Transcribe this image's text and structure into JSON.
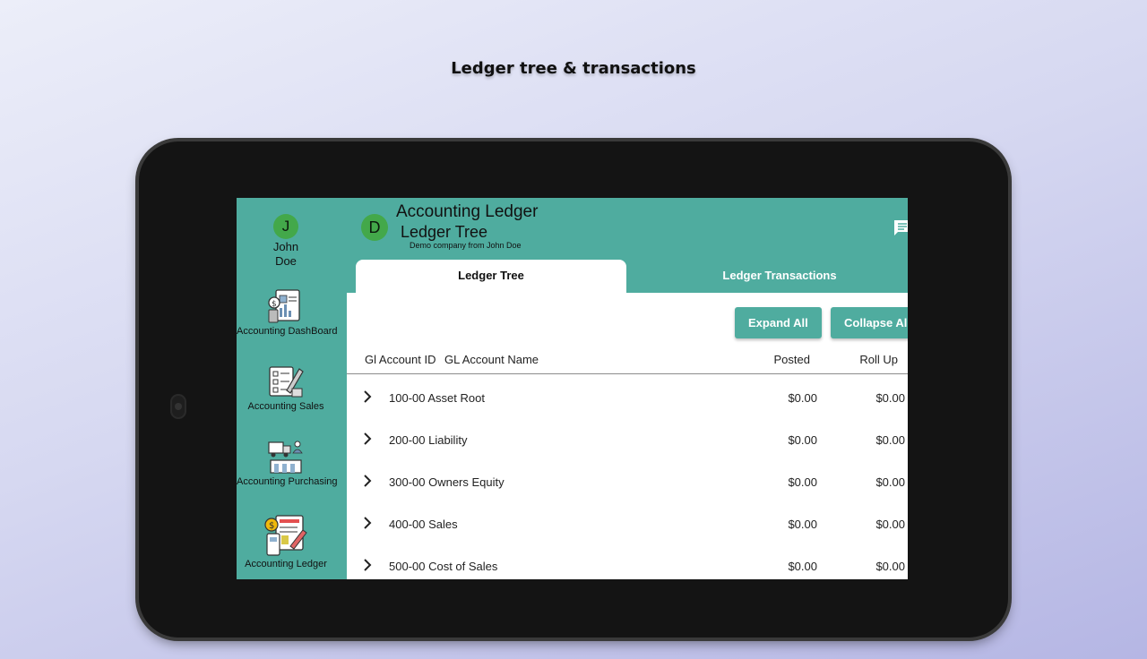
{
  "caption": "Ledger tree & transactions",
  "rail": {
    "user_initial": "J",
    "user_name_line1": "John",
    "user_name_line2": "Doe",
    "items": [
      {
        "label": "Accounting DashBoard",
        "icon": "dashboard-icon"
      },
      {
        "label": "Accounting Sales",
        "icon": "sales-icon"
      },
      {
        "label": "Accounting Purchasing",
        "icon": "purchasing-icon"
      },
      {
        "label": "Accounting Ledger",
        "icon": "ledger-icon"
      }
    ]
  },
  "header": {
    "company_initial": "D",
    "title": "Accounting Ledger",
    "subtitle": "Ledger Tree",
    "company": "Demo company from John Doe",
    "chat_icon": "chat-icon"
  },
  "tabs": [
    "Ledger Tree",
    "Ledger Transactions"
  ],
  "actions": {
    "expand": "Expand All",
    "collapse": "Collapse All"
  },
  "table": {
    "columns": [
      "Gl Account ID",
      "GL Account Name",
      "Posted",
      "Roll Up"
    ],
    "rows": [
      {
        "name": "100-00 Asset Root",
        "posted": "$0.00",
        "rollup": "$0.00"
      },
      {
        "name": "200-00 Liability",
        "posted": "$0.00",
        "rollup": "$0.00"
      },
      {
        "name": "300-00 Owners Equity",
        "posted": "$0.00",
        "rollup": "$0.00"
      },
      {
        "name": "400-00 Sales",
        "posted": "$0.00",
        "rollup": "$0.00"
      },
      {
        "name": "500-00 Cost of Sales",
        "posted": "$0.00",
        "rollup": "$0.00"
      }
    ]
  },
  "colors": {
    "primary": "#4fac9f",
    "avatar": "#43a84a"
  }
}
